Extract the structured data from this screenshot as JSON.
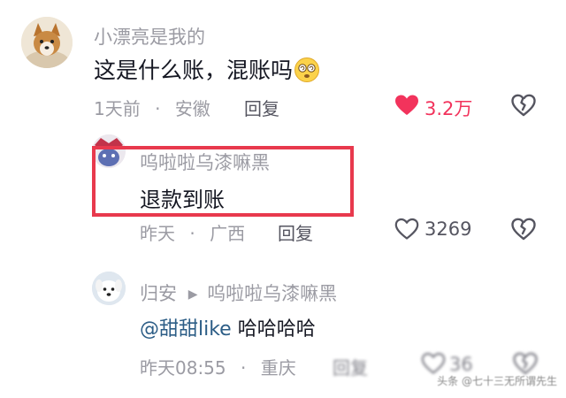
{
  "colors": {
    "liked": "#f2335c",
    "highlight_border": "#e8394d",
    "mention": "#2c5d86",
    "meta": "#9b9ba3"
  },
  "comments": [
    {
      "username": "小漂亮是我的",
      "text": "这是什么账，混账吗",
      "emoji_icon": "dizzy-eyes-emoji-icon",
      "time": "1天前",
      "location": "安徽",
      "reply_label": "回复",
      "likes": "3.2万",
      "liked": true
    },
    {
      "username": "呜啦啦乌漆嘛黑",
      "text": "退款到账",
      "time": "昨天",
      "location": "广西",
      "reply_label": "回复",
      "likes": "3269",
      "liked": false
    },
    {
      "username": "归安",
      "reply_to": "呜啦啦乌漆嘛黑",
      "mention": "@甜甜like",
      "text": "哈哈哈哈",
      "time": "昨天08:55",
      "location": "重庆",
      "reply_label": "回复",
      "likes": "36",
      "liked": false
    }
  ],
  "separator": "·",
  "watermark": "头条 @七十三无所谓先生"
}
